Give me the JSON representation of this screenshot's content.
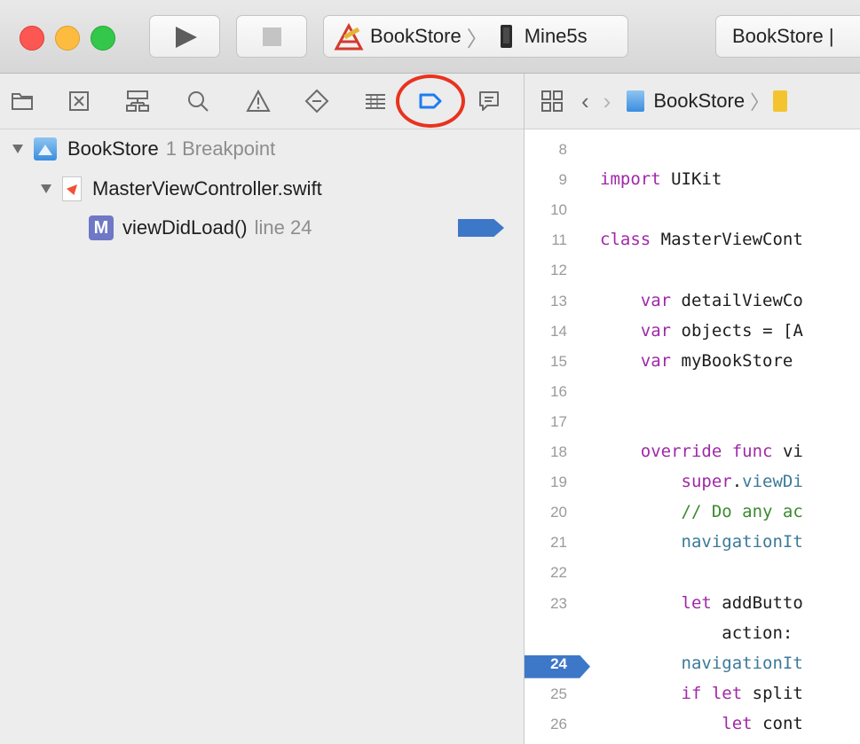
{
  "toolbar": {
    "scheme_target": "BookStore",
    "scheme_device": "Mine5s",
    "status_text": "BookStore  |"
  },
  "navigator": {
    "tabs": [
      {
        "name": "project-navigator",
        "icon": "folder-icon"
      },
      {
        "name": "symbol-navigator",
        "icon": "symbol-icon"
      },
      {
        "name": "find-navigator",
        "icon": "hierarchy-icon"
      },
      {
        "name": "search-navigator",
        "icon": "search-icon"
      },
      {
        "name": "issue-navigator",
        "icon": "warning-icon"
      },
      {
        "name": "test-navigator",
        "icon": "diamond-icon"
      },
      {
        "name": "debug-navigator",
        "icon": "list-icon"
      },
      {
        "name": "breakpoint-navigator",
        "icon": "breakpoint-icon",
        "selected": true
      },
      {
        "name": "report-navigator",
        "icon": "report-icon"
      }
    ],
    "highlight_color": "#e8331f",
    "project_name": "BookStore",
    "project_count": "1 Breakpoint",
    "file_name": "MasterViewController.swift",
    "method_badge": "M",
    "method_name": "viewDidLoad()",
    "method_line": "line 24",
    "breakpoint_color": "#3d78c8"
  },
  "editor": {
    "jump_bar": {
      "crumb": "BookStore"
    },
    "lines": [
      {
        "n": "8",
        "code": ""
      },
      {
        "n": "9",
        "code": "import UIKit"
      },
      {
        "n": "10",
        "code": ""
      },
      {
        "n": "11",
        "code": "class MasterViewCont"
      },
      {
        "n": "12",
        "code": ""
      },
      {
        "n": "13",
        "code": "    var detailViewCo"
      },
      {
        "n": "14",
        "code": "    var objects = [A"
      },
      {
        "n": "15",
        "code": "    var myBookStore "
      },
      {
        "n": "16",
        "code": ""
      },
      {
        "n": "17",
        "code": ""
      },
      {
        "n": "18",
        "code": "    override func vi"
      },
      {
        "n": "19",
        "code": "        super.viewDi"
      },
      {
        "n": "20",
        "code": "        // Do any ac"
      },
      {
        "n": "21",
        "code": "        navigationIt"
      },
      {
        "n": "22",
        "code": ""
      },
      {
        "n": "23",
        "code": "        let addButto"
      },
      {
        "n": "",
        "code": "            action: "
      },
      {
        "n": "24",
        "code": "        navigationIt",
        "breakpoint": true
      },
      {
        "n": "25",
        "code": "        if let split"
      },
      {
        "n": "26",
        "code": "            let cont"
      }
    ]
  }
}
